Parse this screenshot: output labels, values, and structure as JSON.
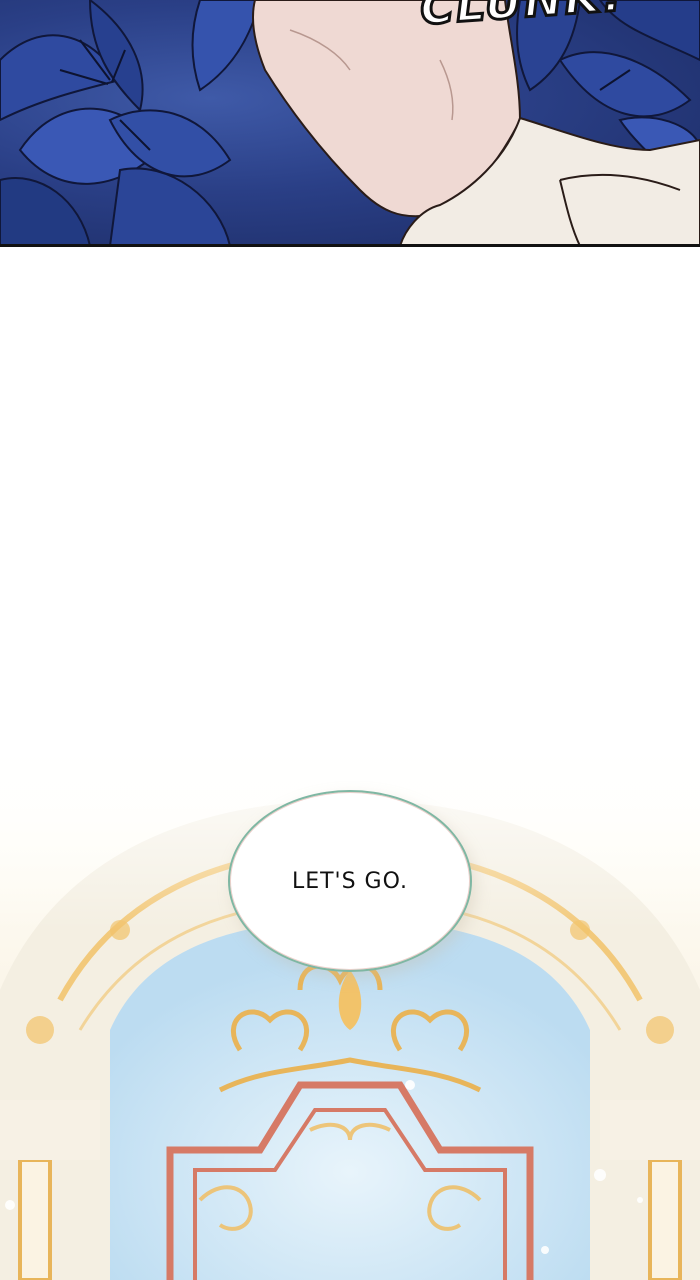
{
  "panel_top": {
    "sound_effect": "CLUNK!",
    "colors": {
      "flowers": "#2a3f86",
      "hand": "#efd9d3",
      "sleeve": "#f2ece4"
    }
  },
  "panel_bottom": {
    "speech_bubble": {
      "text": "LET'S GO."
    },
    "colors": {
      "sky": "#cfe6f6",
      "gold": "#f2c36a",
      "gate": "#d67a66",
      "stone": "#f4efe2"
    }
  }
}
